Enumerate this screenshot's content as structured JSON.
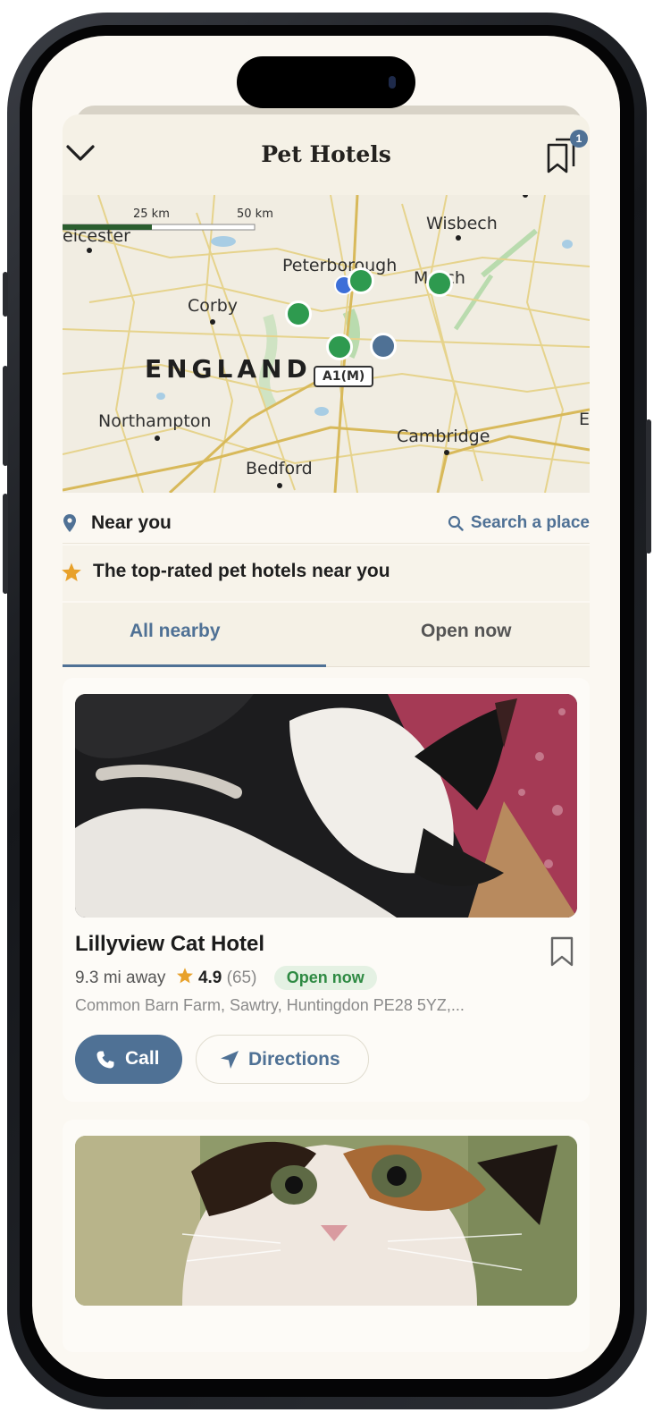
{
  "header": {
    "title": "Pet Hotels",
    "saved_count": "1"
  },
  "map": {
    "scale_labels": [
      "25 km",
      "50 km"
    ],
    "place_labels": {
      "leicester": "eicester",
      "wisbech": "Wisbech",
      "peterborough": "Peterborough",
      "march": "March",
      "corby": "Corby",
      "england": "ENGLAND",
      "road": "A1(M)",
      "northampton": "Northampton",
      "cambridge": "Cambridge",
      "bedford": "Bedford",
      "edge_e": "E"
    },
    "pin_colors": {
      "hotel": "#2e9a4f",
      "user": "#4f7195"
    }
  },
  "location": {
    "near_label": "Near you",
    "search_label": "Search a place"
  },
  "list_heading": "The top-rated pet hotels near you",
  "tabs": [
    {
      "label": "All nearby",
      "selected": true
    },
    {
      "label": "Open now",
      "selected": false
    }
  ],
  "cards": [
    {
      "name": "Lillyview Cat Hotel",
      "distance": "9.3 mi away",
      "rating": "4.9",
      "reviews": "(65)",
      "status": "Open now",
      "address": "Common Barn Farm, Sawtry, Huntingdon PE28 5YZ,...",
      "call_label": "Call",
      "directions_label": "Directions"
    }
  ],
  "colors": {
    "accent": "#4f7195",
    "star": "#e8a12a",
    "open": "#2e8a43",
    "background": "#fbf8f2"
  }
}
